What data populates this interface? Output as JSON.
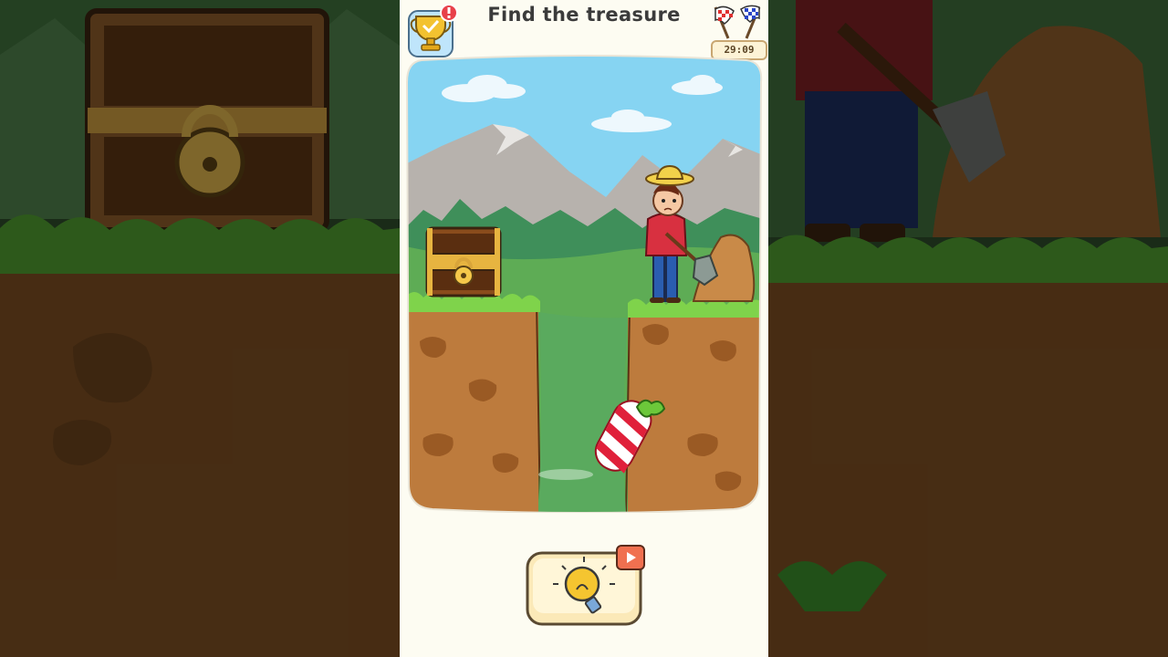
{
  "game": {
    "title": "Find the treasure",
    "timer": "29:09"
  },
  "icons": {
    "trophy": "trophy-icon",
    "alert": "exclamation-badge-icon",
    "flags": "checkered-flags-icon",
    "hint": "lightbulb-icon",
    "video": "play-video-icon"
  },
  "colors": {
    "sky": "#86d4f2",
    "grass": "#7bd24a",
    "dirt": "#b9793e",
    "panel": "#fdfcf2"
  }
}
